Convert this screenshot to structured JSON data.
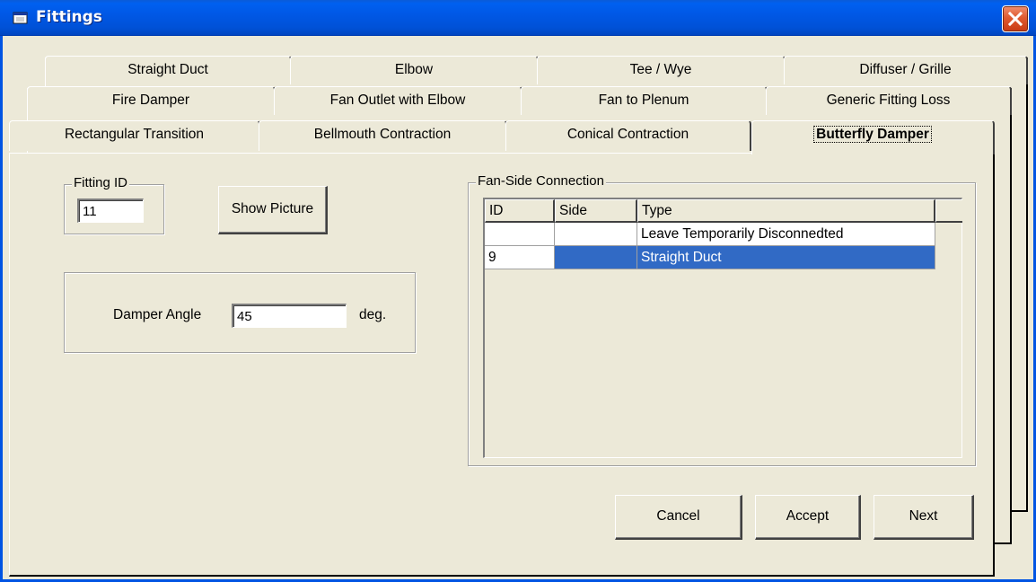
{
  "window": {
    "title": "Fittings",
    "close_label": "✕"
  },
  "tabs": {
    "row1": [
      "Straight Duct",
      "Elbow",
      "Tee / Wye",
      "Diffuser / Grille"
    ],
    "row2": [
      "Fire Damper",
      "Fan Outlet with Elbow",
      "Fan to Plenum",
      "Generic Fitting Loss"
    ],
    "row3": [
      "Rectangular Transition",
      "Bellmouth Contraction",
      "Conical Contraction",
      "Butterfly Damper"
    ],
    "active": "Butterfly Damper"
  },
  "fitting_id": {
    "label": "Fitting ID",
    "value": "11"
  },
  "show_picture_label": "Show Picture",
  "damper": {
    "label": "Damper Angle",
    "value": "45",
    "unit": "deg."
  },
  "connection": {
    "label": "Fan-Side Connection",
    "columns": [
      "ID",
      "Side",
      "Type"
    ],
    "rows": [
      {
        "id": "",
        "side": "",
        "type": "Leave Temporarily Disconnedted",
        "selected": false
      },
      {
        "id": "9",
        "side": "",
        "type": "Straight Duct",
        "selected": true
      }
    ]
  },
  "buttons": {
    "cancel": "Cancel",
    "accept": "Accept",
    "next": "Next"
  },
  "colors": {
    "titlebar": "#0054e3",
    "selection": "#316ac5",
    "face": "#ece9d8"
  }
}
